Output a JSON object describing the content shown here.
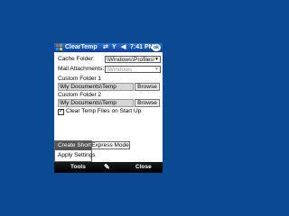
{
  "colors": {
    "desktop_background": "#0b4a92",
    "title_bar": "#0a3f9a",
    "softkey_bar": "#000000",
    "menu_highlight": "#555555"
  },
  "titlebar": {
    "app_title": "ClearTemp",
    "start_icon": "windows-flag-icon",
    "status_icons": [
      "connectivity-icon",
      "signal-icon",
      "volume-icon"
    ],
    "clock": "7:41 PM",
    "ok_label": "ok"
  },
  "form": {
    "cache_folder": {
      "label": "Cache Folder:",
      "value": "\\Windows\\Profiles\\guest"
    },
    "mail_attachments": {
      "label": "Mail Attachments:",
      "value": "\\Windows"
    },
    "custom_folder_1": {
      "label": "Custom Folder 1",
      "value": "\\My Documents\\Temp",
      "browse_label": "Browse"
    },
    "custom_folder_2": {
      "label": "Custom Folder 2",
      "value": "\\My Documents\\Temp",
      "browse_label": "Browse"
    },
    "clear_on_startup": {
      "label": "Clear Temp Files on Start Up",
      "checked": true
    }
  },
  "popup_menu": {
    "items": [
      "Create Shortcut",
      "Apply Settings"
    ]
  },
  "tab": {
    "label": "Express Mode"
  },
  "softkeys": {
    "left": "Tools",
    "right": "Close",
    "sip_icon": "keyboard-pen-icon"
  }
}
